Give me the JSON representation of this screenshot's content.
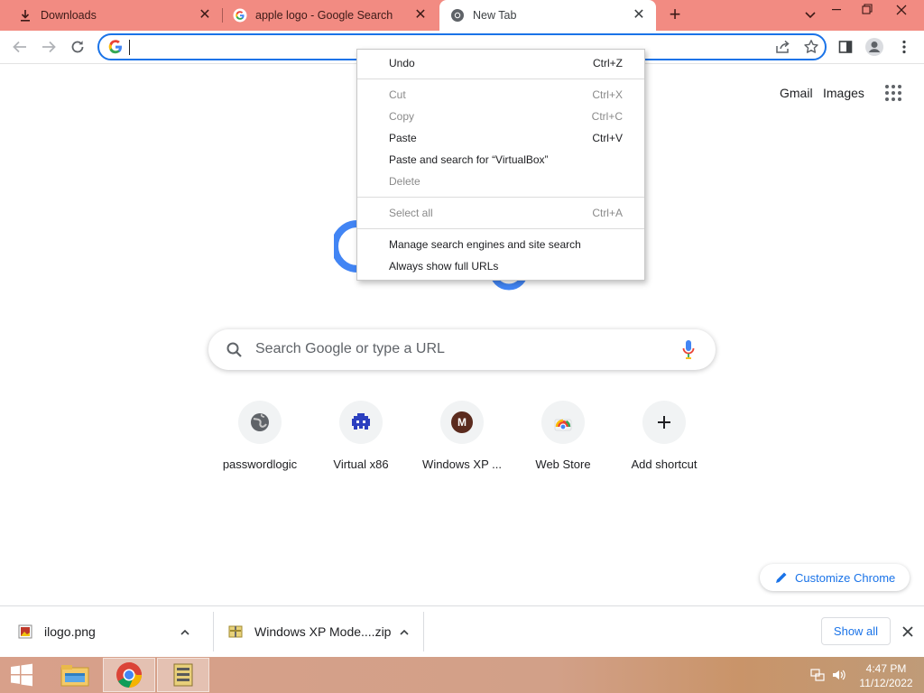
{
  "browser": {
    "tabs": [
      {
        "title": "Downloads",
        "icon": "download-icon",
        "active": false
      },
      {
        "title": "apple logo - Google Search",
        "icon": "google-icon",
        "active": false
      },
      {
        "title": "New Tab",
        "icon": "chrome-icon",
        "active": true
      }
    ],
    "omnibox": {
      "value": "",
      "placeholder": ""
    }
  },
  "ntp": {
    "header_links": [
      "Gmail",
      "Images"
    ],
    "search_placeholder": "Search Google or type a URL",
    "shortcuts": [
      {
        "label": "passwordlogic",
        "icon": "globe-icon"
      },
      {
        "label": "Virtual x86",
        "icon": "pixel-invader-icon"
      },
      {
        "label": "Windows XP ...",
        "icon": "m-letter-icon",
        "letter": "M"
      },
      {
        "label": "Web Store",
        "icon": "web-store-icon"
      },
      {
        "label": "Add shortcut",
        "icon": "plus-icon"
      }
    ],
    "customize_label": "Customize Chrome"
  },
  "context_menu": {
    "groups": [
      [
        {
          "label": "Undo",
          "shortcut": "Ctrl+Z",
          "enabled": true
        }
      ],
      [
        {
          "label": "Cut",
          "shortcut": "Ctrl+X",
          "enabled": false
        },
        {
          "label": "Copy",
          "shortcut": "Ctrl+C",
          "enabled": false
        },
        {
          "label": "Paste",
          "shortcut": "Ctrl+V",
          "enabled": true
        },
        {
          "label": "Paste and search for “VirtualBox”",
          "shortcut": "",
          "enabled": true
        },
        {
          "label": "Delete",
          "shortcut": "",
          "enabled": false
        }
      ],
      [
        {
          "label": "Select all",
          "shortcut": "Ctrl+A",
          "enabled": false
        }
      ],
      [
        {
          "label": "Manage search engines and site search",
          "shortcut": "",
          "enabled": true
        },
        {
          "label": "Always show full URLs",
          "shortcut": "",
          "enabled": true
        }
      ]
    ]
  },
  "download_shelf": {
    "items": [
      {
        "name": "ilogo.png",
        "icon": "image-file-icon"
      },
      {
        "name": "Windows XP Mode....zip",
        "icon": "zip-file-icon"
      }
    ],
    "show_all_label": "Show all"
  },
  "taskbar": {
    "apps": [
      {
        "name": "file-explorer-icon",
        "active": false
      },
      {
        "name": "chrome-icon",
        "active": true
      },
      {
        "name": "archive-app-icon",
        "active": false
      }
    ],
    "time": "4:47 PM",
    "date": "11/12/2022"
  },
  "colors": {
    "tab_strip": "#f28b82",
    "accent": "#1a73e8",
    "taskbar": "#d4a08a"
  }
}
